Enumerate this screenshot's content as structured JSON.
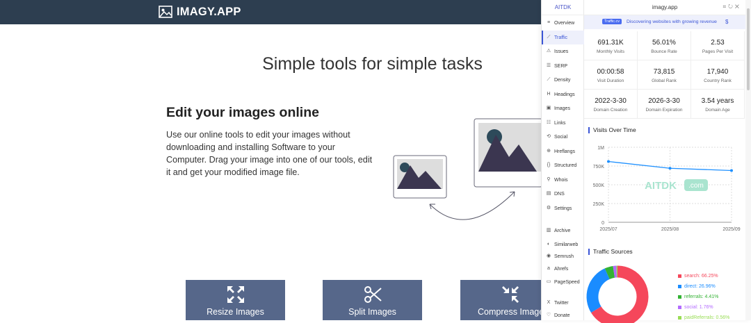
{
  "site": {
    "logo_text": "IMAGY.APP",
    "hero_title": "Simple tools for simple tasks",
    "section_title": "Edit your images online",
    "description": "Use our online tools to edit your images without downloading and installing Software to your Computer. Drag your image into one of our tools, edit it and get your modified image file.",
    "tools": [
      {
        "label": "Resize Images",
        "icon": "expand-arrows-icon"
      },
      {
        "label": "Split Images",
        "icon": "scissors-icon"
      },
      {
        "label": "Compress Images",
        "icon": "compress-arrows-icon"
      }
    ]
  },
  "extension": {
    "brand": "AITDK",
    "domain": "imagy.app",
    "banner_tag": "Traffic.cv",
    "banner_text": "Discovering websites with growing revenue",
    "banner_dollar": "$",
    "nav": [
      {
        "label": "Overview",
        "icon": "≡"
      },
      {
        "label": "Traffic",
        "icon": "⟋"
      },
      {
        "label": "Issues",
        "icon": "⚠"
      },
      {
        "label": "SERP",
        "icon": "☰"
      },
      {
        "label": "Density",
        "icon": "⟋"
      },
      {
        "label": "Headings",
        "icon": "H"
      },
      {
        "label": "Images",
        "icon": "▣"
      },
      {
        "label": "Links",
        "icon": "☷"
      },
      {
        "label": "Social",
        "icon": "⟲"
      },
      {
        "label": "Hreflangs",
        "icon": "⊕"
      },
      {
        "label": "Structured",
        "icon": "{}"
      },
      {
        "label": "Whois",
        "icon": "⚲"
      },
      {
        "label": "DNS",
        "icon": "▤"
      },
      {
        "label": "Settings",
        "icon": "⚙"
      },
      {
        "label": "Archive",
        "icon": "▥"
      },
      {
        "label": "Similarweb",
        "icon": "◐"
      },
      {
        "label": "Semrush",
        "icon": "◉"
      },
      {
        "label": "Ahrefs",
        "icon": "a"
      },
      {
        "label": "PageSpeed",
        "icon": "▭"
      },
      {
        "label": "Twitter",
        "icon": "X"
      },
      {
        "label": "Donate",
        "icon": "♡"
      }
    ],
    "stats": [
      {
        "value": "691.31K",
        "label": "Monthly Visits"
      },
      {
        "value": "56.01%",
        "label": "Bounce Rate"
      },
      {
        "value": "2.53",
        "label": "Pages Per Visit"
      },
      {
        "value": "00:00:58",
        "label": "Visit Duration"
      },
      {
        "value": "73,815",
        "label": "Global Rank"
      },
      {
        "value": "17,940",
        "label": "Country Rank"
      },
      {
        "value": "2022-3-30",
        "label": "Domain Creation"
      },
      {
        "value": "2026-3-30",
        "label": "Domain Expiration"
      },
      {
        "value": "3.54 years",
        "label": "Domain Age"
      }
    ],
    "visits_title": "Visits Over Time",
    "watermark": "AITDK",
    "watermark_suffix": ".com",
    "sources_title": "Traffic Sources",
    "colors": {
      "accent": "#3b55d6",
      "line": "#1e90ff"
    }
  },
  "chart_data": [
    {
      "type": "line",
      "title": "Visits Over Time",
      "x": [
        "2025/07",
        "2025/08",
        "2025/09"
      ],
      "series": [
        {
          "values": [
            810000,
            720000,
            690000
          ]
        }
      ],
      "yticks": [
        "0",
        "250K",
        "500K",
        "750K",
        "1M"
      ],
      "ylim": [
        0,
        1000000
      ],
      "grid": true
    },
    {
      "type": "pie",
      "title": "Traffic Sources",
      "slices": [
        {
          "label": "search: 66.25%",
          "value": 66.25,
          "color": "#f5475b"
        },
        {
          "label": "direct: 26.96%",
          "value": 26.96,
          "color": "#1a8cff"
        },
        {
          "label": "referrals: 4.41%",
          "value": 4.41,
          "color": "#33b233"
        },
        {
          "label": "social: 1.76%",
          "value": 1.76,
          "color": "#b36bff"
        },
        {
          "label": "paidReferrals: 0.56%",
          "value": 0.56,
          "color": "#99dd55"
        }
      ]
    }
  ]
}
